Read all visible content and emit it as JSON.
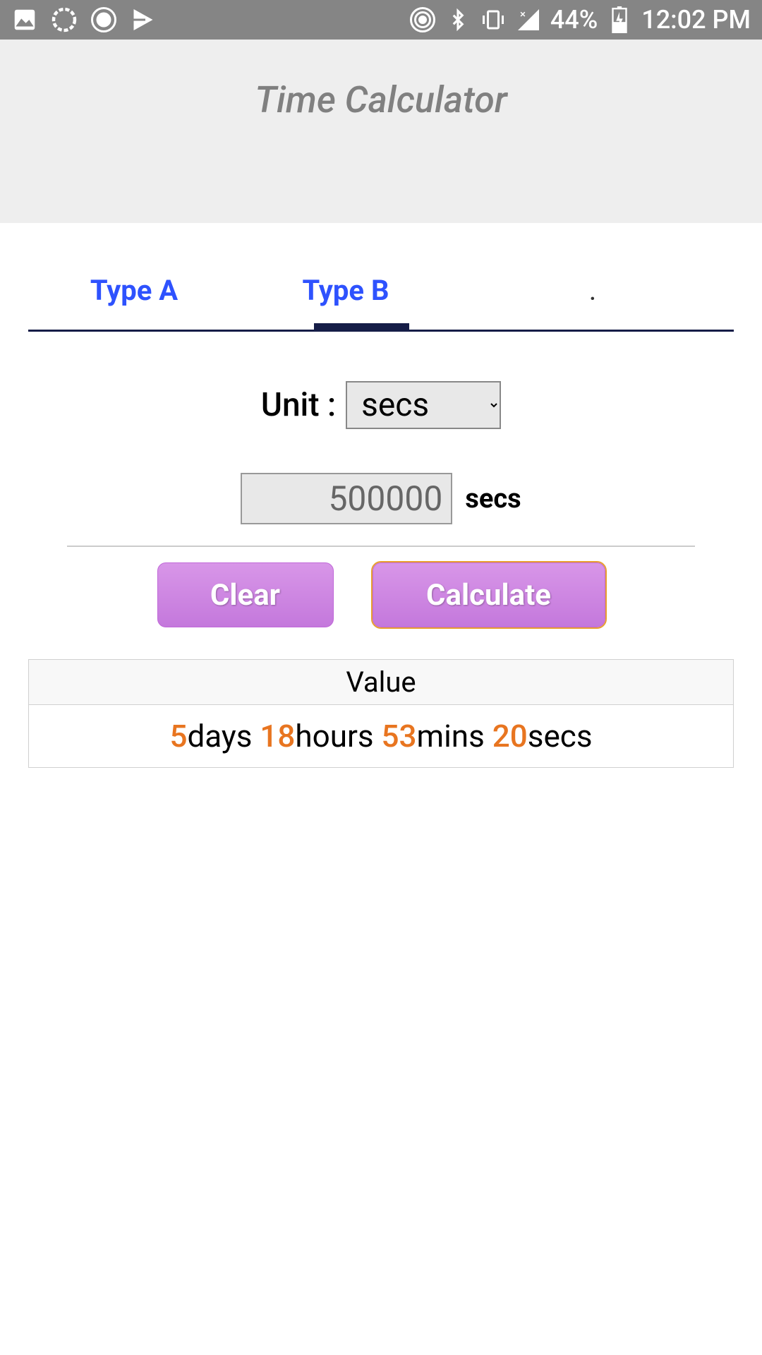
{
  "status_bar": {
    "battery_percent": "44%",
    "time": "12:02 PM"
  },
  "header": {
    "title": "Time Calculator"
  },
  "tabs": {
    "a": "Type A",
    "b": "Type B",
    "dot": "."
  },
  "unit": {
    "label": "Unit :",
    "selected": "secs"
  },
  "input": {
    "value": "500000",
    "unit": "secs"
  },
  "buttons": {
    "clear": "Clear",
    "calculate": "Calculate"
  },
  "result": {
    "header": "Value",
    "days": "5",
    "days_label": "days ",
    "hours": "18",
    "hours_label": "hours ",
    "mins": "53",
    "mins_label": "mins ",
    "secs": "20",
    "secs_label": "secs"
  }
}
